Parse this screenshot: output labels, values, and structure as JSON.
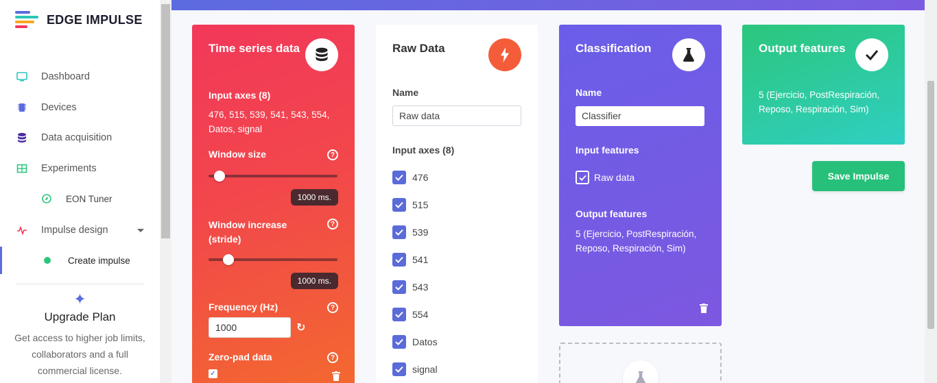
{
  "app": {
    "name": "EDGE IMPULSE"
  },
  "nav": {
    "items": [
      {
        "label": "Dashboard",
        "icon": "monitor-icon"
      },
      {
        "label": "Devices",
        "icon": "chip-icon"
      },
      {
        "label": "Data acquisition",
        "icon": "database-icon"
      },
      {
        "label": "Experiments",
        "icon": "table-icon"
      },
      {
        "label": "EON Tuner",
        "icon": "compass-icon"
      },
      {
        "label": "Impulse design",
        "icon": "pulse-icon"
      },
      {
        "label": "Create impulse",
        "icon": "dot-icon"
      }
    ]
  },
  "upgrade": {
    "title": "Upgrade Plan",
    "text": "Get access to higher job limits, collaborators and a full commercial license."
  },
  "time_series": {
    "title": "Time series data",
    "input_axes_label": "Input axes (8)",
    "input_axes_value": "476, 515, 539, 541, 543, 554, Datos, signal",
    "window_size_label": "Window size",
    "window_size_value": "1000 ms.",
    "window_size_fraction": 0.04,
    "window_increase_label": "Window increase (stride)",
    "window_increase_value": "1000 ms.",
    "window_increase_fraction": 0.11,
    "frequency_label": "Frequency (Hz)",
    "frequency_value": "1000",
    "zero_pad_label": "Zero-pad data",
    "zero_pad_checked": true
  },
  "raw_data": {
    "title": "Raw Data",
    "name_label": "Name",
    "name_value": "Raw data",
    "input_axes_label": "Input axes (8)",
    "axes": [
      "476",
      "515",
      "539",
      "541",
      "543",
      "554",
      "Datos",
      "signal"
    ]
  },
  "classification": {
    "title": "Classification",
    "name_label": "Name",
    "name_value": "Classifier",
    "input_features_label": "Input features",
    "input_feature": "Raw data",
    "output_features_label": "Output features",
    "output_features_value": "5 (Ejercicio, PostRespiración, Reposo, Respiración, Sim)"
  },
  "output": {
    "title": "Output features",
    "value": "5 (Ejercicio, PostRespiración, Reposo, Respiración, Sim)"
  },
  "save_button": "Save Impulse",
  "colors": {
    "time_series": "#f2385a",
    "raw_data_icon": "#f45c3a",
    "classification": "#6a5ee8",
    "output": "#2cc67c",
    "save": "#27c07a"
  }
}
